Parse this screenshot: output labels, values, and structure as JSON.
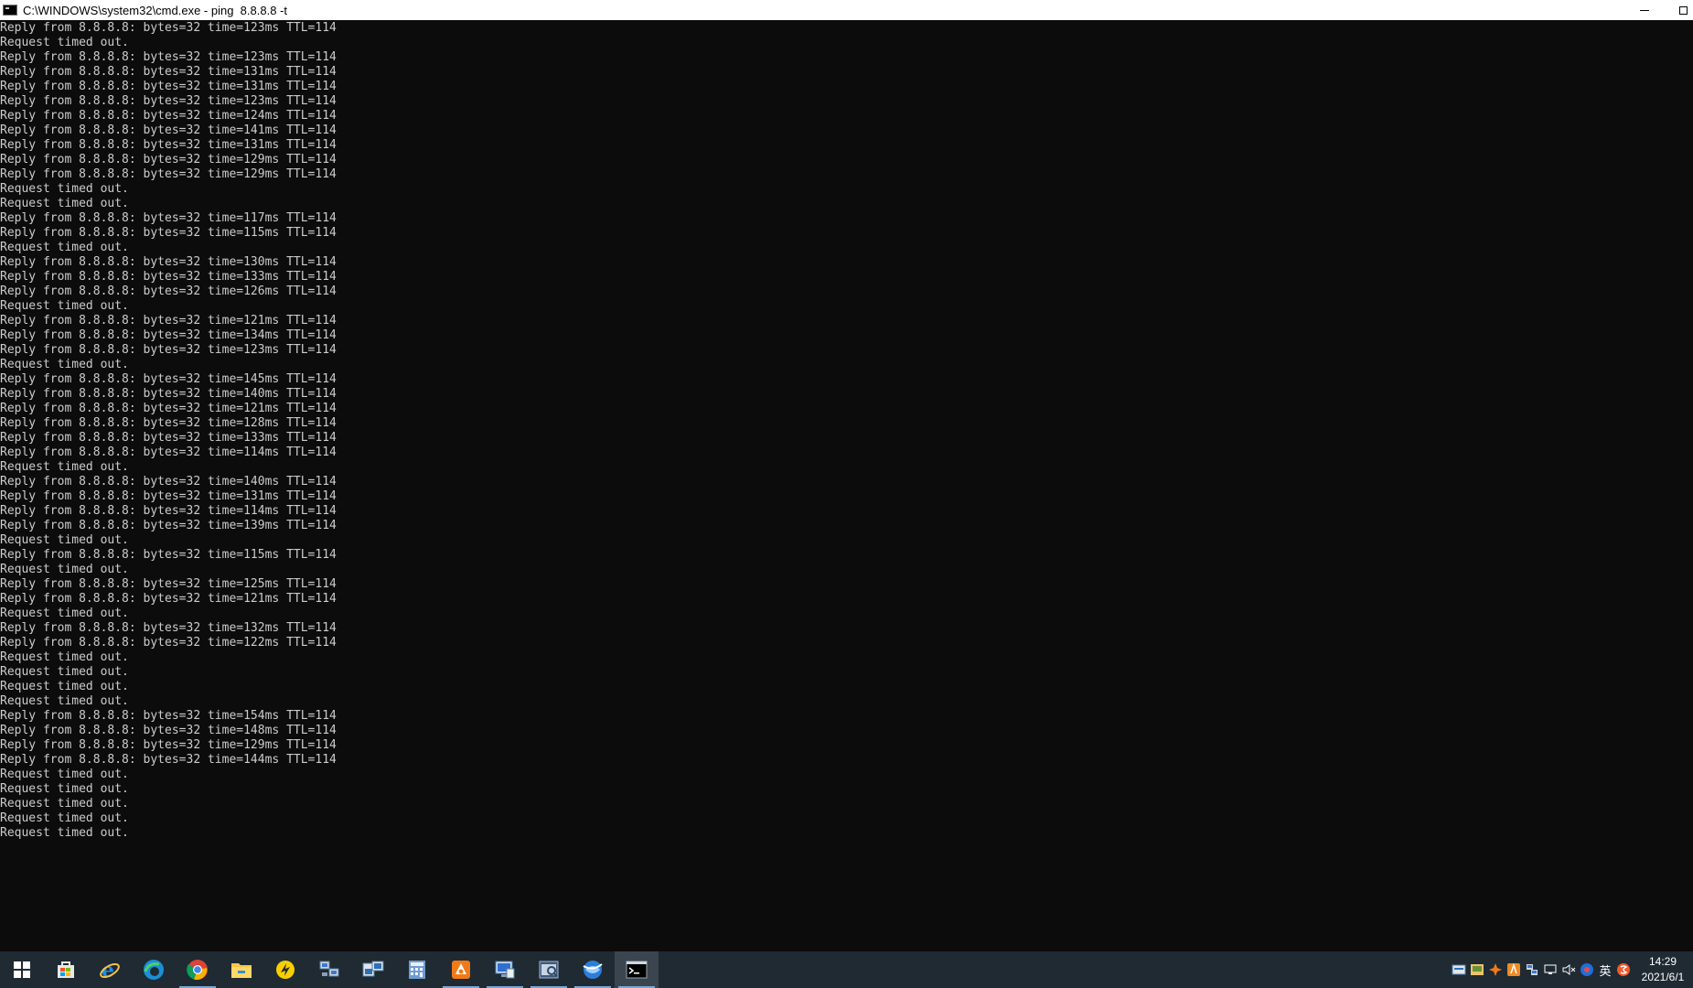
{
  "window": {
    "title": "C:\\WINDOWS\\system32\\cmd.exe - ping  8.8.8.8 -t"
  },
  "console": {
    "lines": [
      "Reply from 8.8.8.8: bytes=32 time=123ms TTL=114",
      "Request timed out.",
      "Reply from 8.8.8.8: bytes=32 time=123ms TTL=114",
      "Reply from 8.8.8.8: bytes=32 time=131ms TTL=114",
      "Reply from 8.8.8.8: bytes=32 time=131ms TTL=114",
      "Reply from 8.8.8.8: bytes=32 time=123ms TTL=114",
      "Reply from 8.8.8.8: bytes=32 time=124ms TTL=114",
      "Reply from 8.8.8.8: bytes=32 time=141ms TTL=114",
      "Reply from 8.8.8.8: bytes=32 time=131ms TTL=114",
      "Reply from 8.8.8.8: bytes=32 time=129ms TTL=114",
      "Reply from 8.8.8.8: bytes=32 time=129ms TTL=114",
      "Request timed out.",
      "Request timed out.",
      "Reply from 8.8.8.8: bytes=32 time=117ms TTL=114",
      "Reply from 8.8.8.8: bytes=32 time=115ms TTL=114",
      "Request timed out.",
      "Reply from 8.8.8.8: bytes=32 time=130ms TTL=114",
      "Reply from 8.8.8.8: bytes=32 time=133ms TTL=114",
      "Reply from 8.8.8.8: bytes=32 time=126ms TTL=114",
      "Request timed out.",
      "Reply from 8.8.8.8: bytes=32 time=121ms TTL=114",
      "Reply from 8.8.8.8: bytes=32 time=134ms TTL=114",
      "Reply from 8.8.8.8: bytes=32 time=123ms TTL=114",
      "Request timed out.",
      "Reply from 8.8.8.8: bytes=32 time=145ms TTL=114",
      "Reply from 8.8.8.8: bytes=32 time=140ms TTL=114",
      "Reply from 8.8.8.8: bytes=32 time=121ms TTL=114",
      "Reply from 8.8.8.8: bytes=32 time=128ms TTL=114",
      "Reply from 8.8.8.8: bytes=32 time=133ms TTL=114",
      "Reply from 8.8.8.8: bytes=32 time=114ms TTL=114",
      "Request timed out.",
      "Reply from 8.8.8.8: bytes=32 time=140ms TTL=114",
      "Reply from 8.8.8.8: bytes=32 time=131ms TTL=114",
      "Reply from 8.8.8.8: bytes=32 time=114ms TTL=114",
      "Reply from 8.8.8.8: bytes=32 time=139ms TTL=114",
      "Request timed out.",
      "Reply from 8.8.8.8: bytes=32 time=115ms TTL=114",
      "Request timed out.",
      "Reply from 8.8.8.8: bytes=32 time=125ms TTL=114",
      "Reply from 8.8.8.8: bytes=32 time=121ms TTL=114",
      "Request timed out.",
      "Reply from 8.8.8.8: bytes=32 time=132ms TTL=114",
      "Reply from 8.8.8.8: bytes=32 time=122ms TTL=114",
      "Request timed out.",
      "Request timed out.",
      "Request timed out.",
      "Request timed out.",
      "Reply from 8.8.8.8: bytes=32 time=154ms TTL=114",
      "Reply from 8.8.8.8: bytes=32 time=148ms TTL=114",
      "Reply from 8.8.8.8: bytes=32 time=129ms TTL=114",
      "Reply from 8.8.8.8: bytes=32 time=144ms TTL=114",
      "Request timed out.",
      "Request timed out.",
      "Request timed out.",
      "Request timed out.",
      "Request timed out."
    ],
    "colors": {
      "background": "#0c0c0c",
      "text": "#cccccc"
    }
  },
  "taskbar": {
    "apps": [
      {
        "name": "start-button",
        "icon": "windows-logo-icon"
      },
      {
        "name": "store-app",
        "icon": "store-bag-icon"
      },
      {
        "name": "ie-app",
        "icon": "internet-explorer-icon"
      },
      {
        "name": "edge-app",
        "icon": "edge-icon"
      },
      {
        "name": "chrome-app",
        "icon": "chrome-icon",
        "running": true
      },
      {
        "name": "file-explorer-app",
        "icon": "folder-icon"
      },
      {
        "name": "yellow-app",
        "icon": "yellow-circle-icon"
      },
      {
        "name": "network-app",
        "icon": "network-computers-icon"
      },
      {
        "name": "remote-app",
        "icon": "remote-desktop-icon"
      },
      {
        "name": "calculator-app",
        "icon": "calculator-icon"
      },
      {
        "name": "orange-app",
        "icon": "orange-app-icon",
        "running": true
      },
      {
        "name": "vm-app",
        "icon": "virtual-machine-icon",
        "running": true
      },
      {
        "name": "manager-app",
        "icon": "manager-window-icon",
        "running": true
      },
      {
        "name": "globe-app",
        "icon": "blue-globe-icon",
        "running": true
      },
      {
        "name": "cmd-app",
        "icon": "command-prompt-icon",
        "running": true,
        "active": true
      }
    ],
    "tray": {
      "icons": [
        "tray-keyboard-icon",
        "tray-app-icon",
        "tray-orange-icon",
        "tray-orange2-icon",
        "tray-network-share-icon",
        "tray-network-icon",
        "tray-volume-muted-icon",
        "tray-blue-icon",
        "tray-ime-icon",
        "tray-sogou-icon"
      ],
      "ime_label": "英",
      "volume_symbol": "🔇"
    },
    "clock": {
      "time": "14:29",
      "date": "2021/6/1"
    }
  }
}
